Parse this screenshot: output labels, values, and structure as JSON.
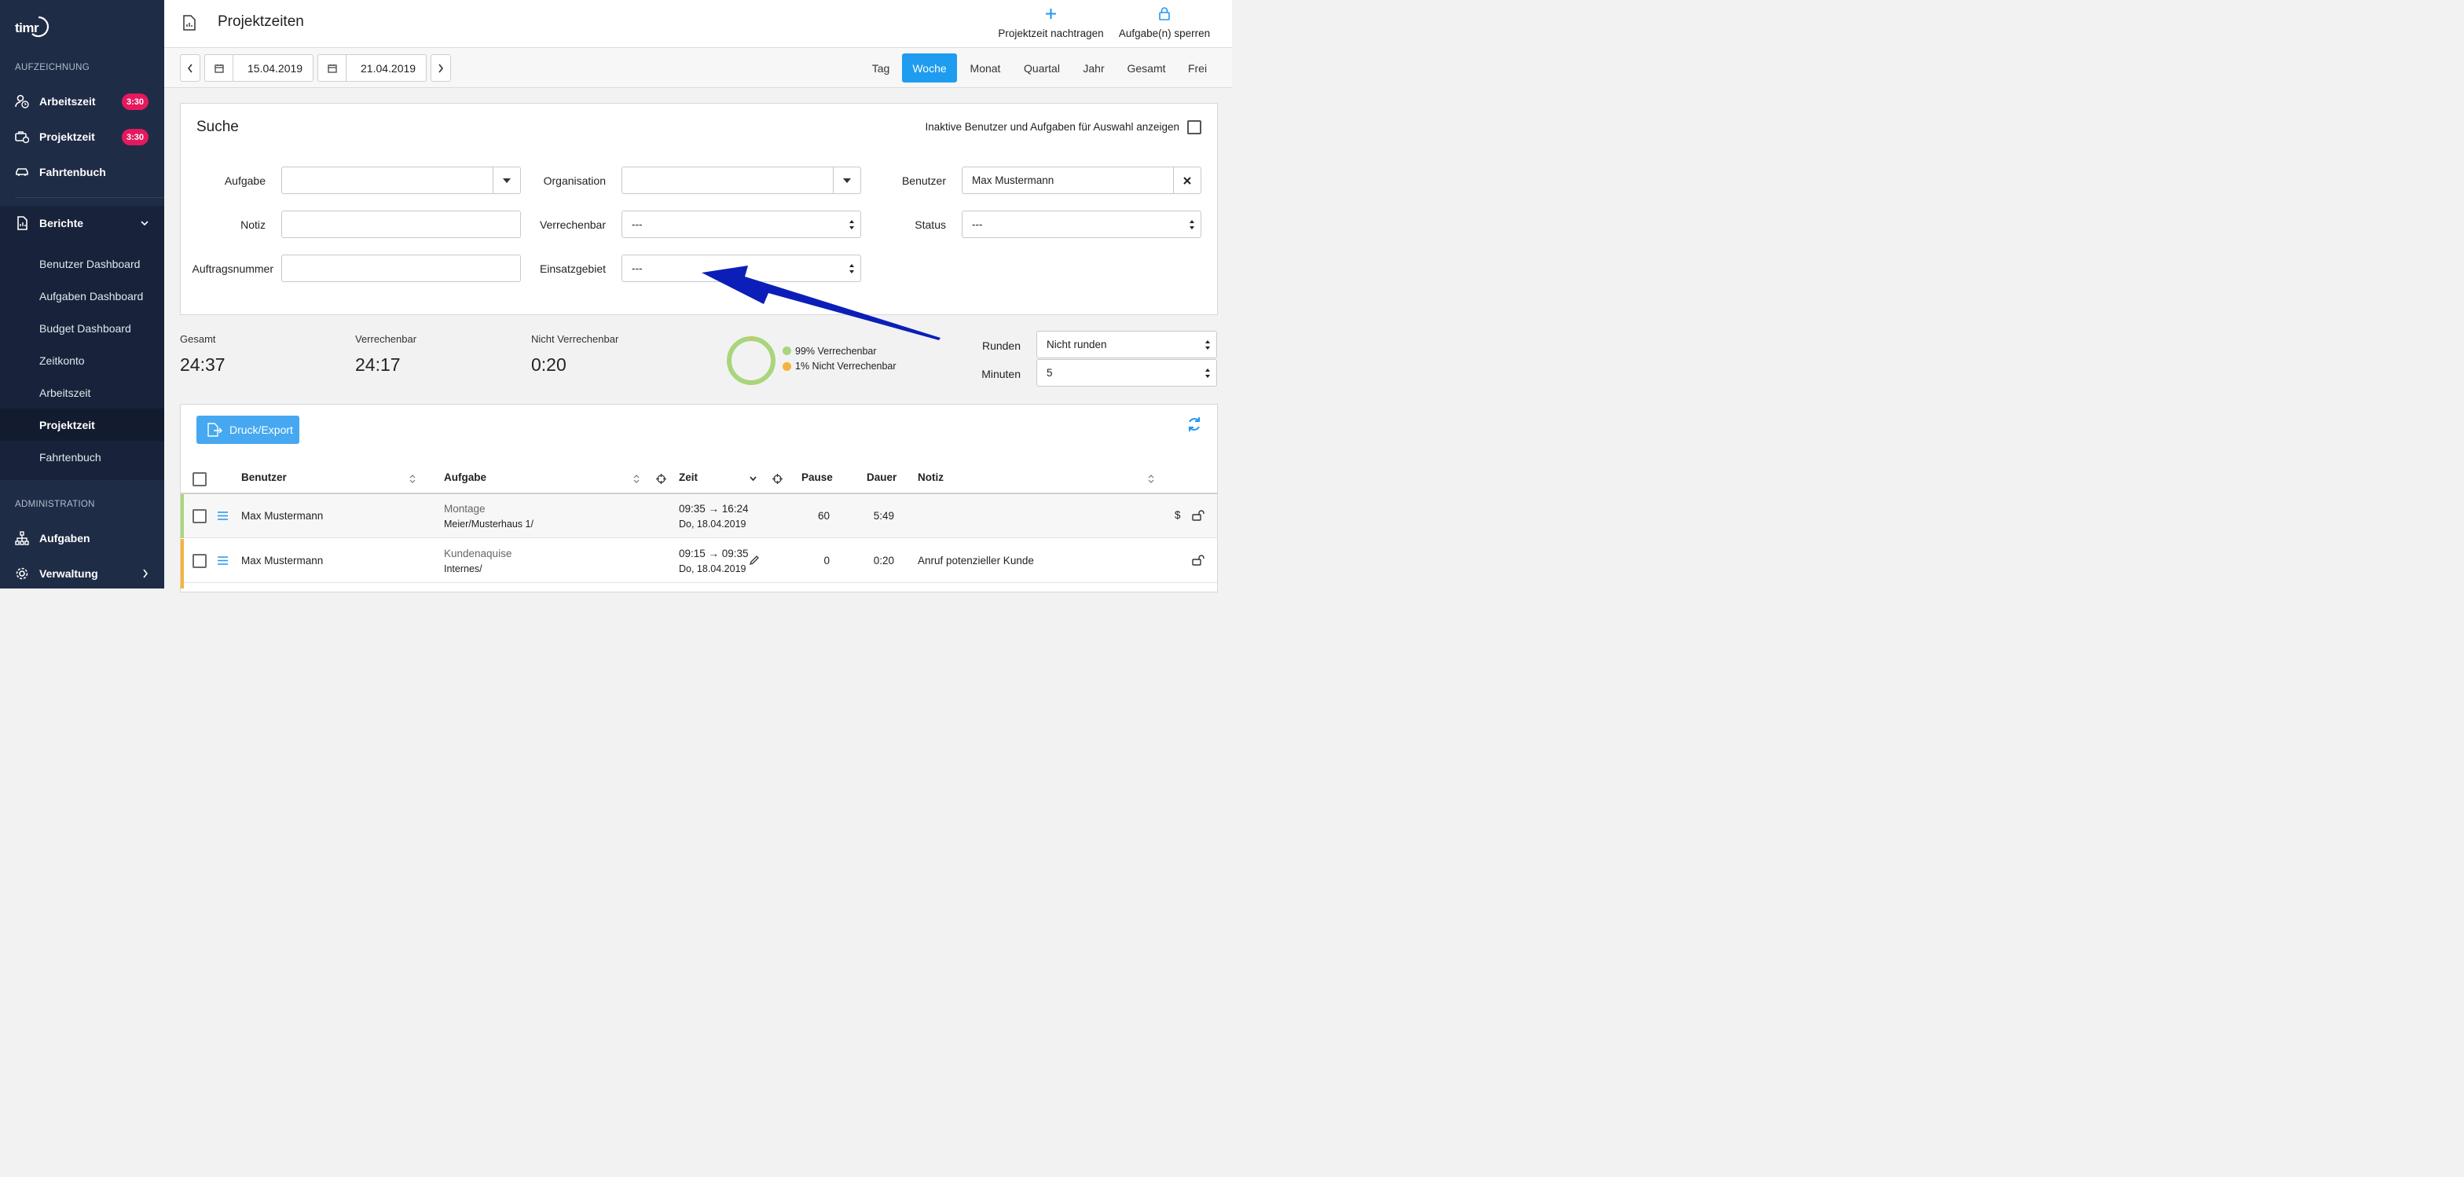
{
  "app": {
    "logo_text": "timr"
  },
  "sidebar": {
    "section_recording": "AUFZEICHNUNG",
    "items_top": [
      {
        "label": "Arbeitszeit",
        "icon": "user-clock-icon",
        "badge": "3:30"
      },
      {
        "label": "Projektzeit",
        "icon": "briefcase-clock-icon",
        "badge": "3:30"
      },
      {
        "label": "Fahrtenbuch",
        "icon": "car-icon",
        "badge": ""
      }
    ],
    "reports": {
      "label": "Berichte",
      "icon": "report-icon"
    },
    "report_items": [
      "Benutzer Dashboard",
      "Aufgaben Dashboard",
      "Budget Dashboard",
      "Zeitkonto",
      "Arbeitszeit",
      "Projektzeit",
      "Fahrtenbuch"
    ],
    "active_report": "Projektzeit",
    "section_admin": "ADMINISTRATION",
    "admin_items": [
      {
        "label": "Aufgaben",
        "icon": "hierarchy-icon"
      },
      {
        "label": "Verwaltung",
        "icon": "gear-icon"
      }
    ]
  },
  "header": {
    "title": "Projektzeiten",
    "actions": [
      {
        "label": "Projektzeit nachtragen",
        "icon": "plus-icon"
      },
      {
        "label": "Aufgabe(n) sperren",
        "icon": "lock-icon"
      }
    ]
  },
  "date_range": {
    "from": "15.04.2019",
    "to": "21.04.2019"
  },
  "periods": [
    "Tag",
    "Woche",
    "Monat",
    "Quartal",
    "Jahr",
    "Gesamt",
    "Frei"
  ],
  "active_period": "Woche",
  "search": {
    "title": "Suche",
    "inactive_toggle_label": "Inaktive Benutzer und Aufgaben für Auswahl anzeigen",
    "fields": {
      "aufgabe": {
        "label": "Aufgabe",
        "value": ""
      },
      "organisation": {
        "label": "Organisation",
        "value": ""
      },
      "benutzer": {
        "label": "Benutzer",
        "value": "Max Mustermann"
      },
      "notiz": {
        "label": "Notiz",
        "value": ""
      },
      "verrechenbar": {
        "label": "Verrechenbar",
        "value": "---"
      },
      "status": {
        "label": "Status",
        "value": "---"
      },
      "auftragsnummer": {
        "label": "Auftragsnummer",
        "value": ""
      },
      "einsatzgebiet": {
        "label": "Einsatzgebiet",
        "value": "---"
      }
    }
  },
  "summary": {
    "gesamt": {
      "label": "Gesamt",
      "value": "24:37"
    },
    "verrechenbar": {
      "label": "Verrechenbar",
      "value": "24:17"
    },
    "nicht_verrechenbar": {
      "label": "Nicht Verrechenbar",
      "value": "0:20"
    },
    "donut": {
      "billable_pct": 99,
      "legend_billable": "99% Verrechenbar",
      "legend_nonbillable": "1% Nicht Verrechenbar",
      "color_billable": "#a9d57c",
      "color_nonbillable": "#f5b33a"
    },
    "runden": {
      "label": "Runden",
      "value": "Nicht runden"
    },
    "minuten": {
      "label": "Minuten",
      "value": "5"
    }
  },
  "table": {
    "export_label": "Druck/Export",
    "columns": {
      "benutzer": "Benutzer",
      "aufgabe": "Aufgabe",
      "zeit": "Zeit",
      "pause": "Pause",
      "dauer": "Dauer",
      "notiz": "Notiz"
    },
    "rows": [
      {
        "user": "Max Mustermann",
        "task": "Montage",
        "task_path": "Meier/Musterhaus 1/",
        "time": "09:35 → 16:24",
        "date": "Do, 18.04.2019",
        "pause": "60",
        "duration": "5:49",
        "note": "",
        "billable_icon": "$",
        "status_color": "#a9d57c"
      },
      {
        "user": "Max Mustermann",
        "task": "Kundenaquise",
        "task_path": "Internes/",
        "time": "09:15 → 09:35",
        "date": "Do, 18.04.2019",
        "pause": "0",
        "duration": "0:20",
        "note": "Anruf potenzieller Kunde",
        "billable_icon": "",
        "status_color": "#f5b33a"
      }
    ]
  },
  "colors": {
    "accent": "#2196f3",
    "sidebar": "#1f2c46",
    "badge": "#e5195d",
    "arrow": "#0b1fb8"
  }
}
